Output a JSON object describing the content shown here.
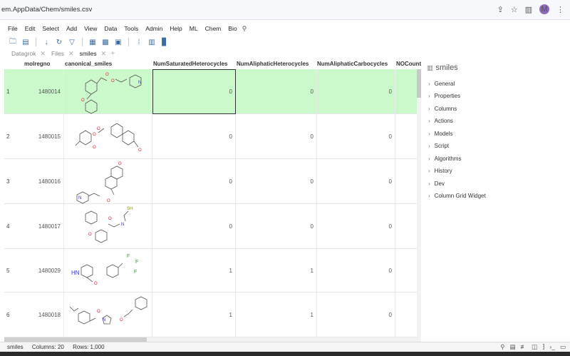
{
  "browser": {
    "address": "em.AppData/Chem/smiles.csv",
    "avatar_letter": "M"
  },
  "menu": [
    "File",
    "Edit",
    "Select",
    "Add",
    "View",
    "Data",
    "Tools",
    "Admin",
    "Help",
    "ML",
    "Chem",
    "Bio"
  ],
  "tabs": [
    {
      "label": "Datagrok",
      "active": false
    },
    {
      "label": "Files",
      "active": false
    },
    {
      "label": "smiles",
      "active": true
    }
  ],
  "grid": {
    "columns": [
      "molregno",
      "canonical_smiles",
      "NumSaturatedHeterocycles",
      "NumAliphaticHeterocycles",
      "NumAliphaticCarbocycles",
      "NOCount"
    ],
    "rows": [
      {
        "idx": "1",
        "molregno": "1480014",
        "sat": "0",
        "ali": "0",
        "carb": "0"
      },
      {
        "idx": "2",
        "molregno": "1480015",
        "sat": "0",
        "ali": "0",
        "carb": "0"
      },
      {
        "idx": "3",
        "molregno": "1480016",
        "sat": "0",
        "ali": "0",
        "carb": "0"
      },
      {
        "idx": "4",
        "molregno": "1480017",
        "sat": "0",
        "ali": "0",
        "carb": "0"
      },
      {
        "idx": "5",
        "molregno": "1480029",
        "sat": "1",
        "ali": "1",
        "carb": "0"
      },
      {
        "idx": "6",
        "molregno": "1480018",
        "sat": "1",
        "ali": "1",
        "carb": "0"
      }
    ],
    "selected_color": "#ccf9cc"
  },
  "panel": {
    "title": "smiles",
    "items": [
      "General",
      "Properties",
      "Columns",
      "Actions",
      "Models",
      "Script",
      "Algorithms",
      "History",
      "Dev",
      "Column Grid Widget"
    ]
  },
  "status": {
    "table": "smiles",
    "columns": "Columns: 20",
    "rows": "Rows: 1,000"
  },
  "atoms": {
    "o": "O",
    "n": "N",
    "sh": "SH",
    "hn": "HN",
    "f": "F"
  }
}
